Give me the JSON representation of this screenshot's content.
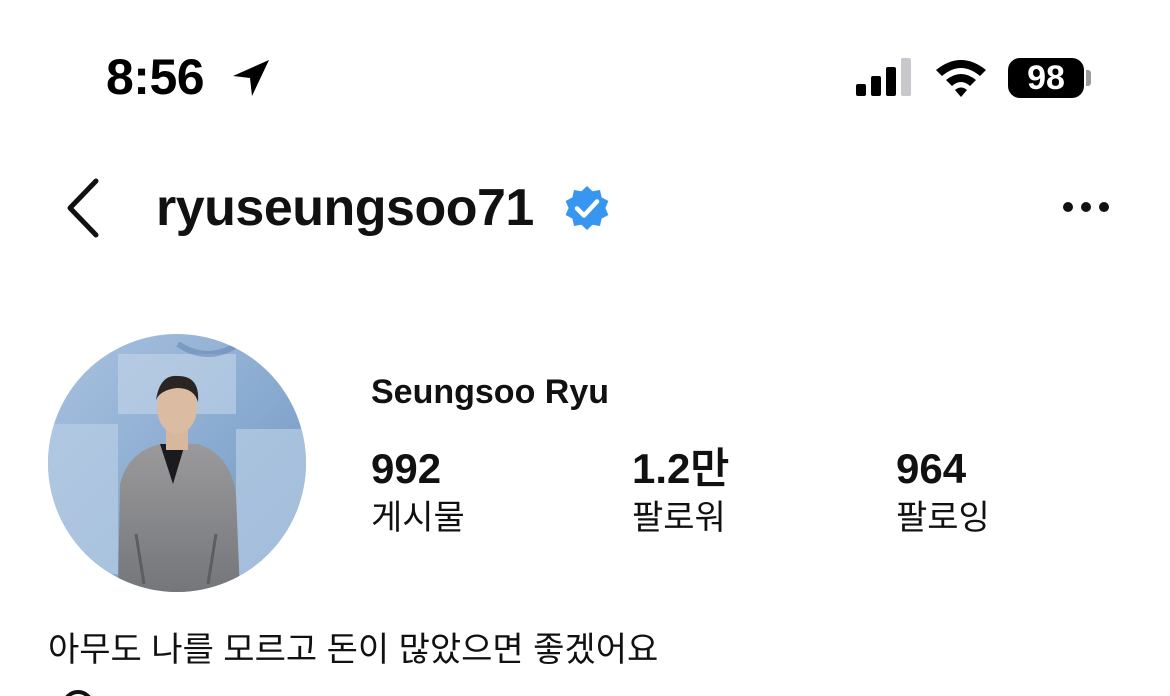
{
  "status_bar": {
    "time": "8:56",
    "battery_level": "98",
    "icons": [
      "location-arrow-icon",
      "cellular-signal-icon",
      "wifi-icon",
      "battery-icon"
    ]
  },
  "header": {
    "username": "ryuseungsoo71",
    "verified": true,
    "verified_color": "#3797f0",
    "icons": [
      "back-chevron-icon",
      "verified-badge-icon",
      "more-options-icon"
    ]
  },
  "profile": {
    "display_name": "Seungsoo Ryu",
    "stats": [
      {
        "count": "992",
        "label": "게시물"
      },
      {
        "count": "1.2만",
        "label": "팔로워"
      },
      {
        "count": "964",
        "label": "팔로잉"
      }
    ],
    "bio": "아무도 나를 모르고 돈이 많았으면 좋겠어요"
  }
}
